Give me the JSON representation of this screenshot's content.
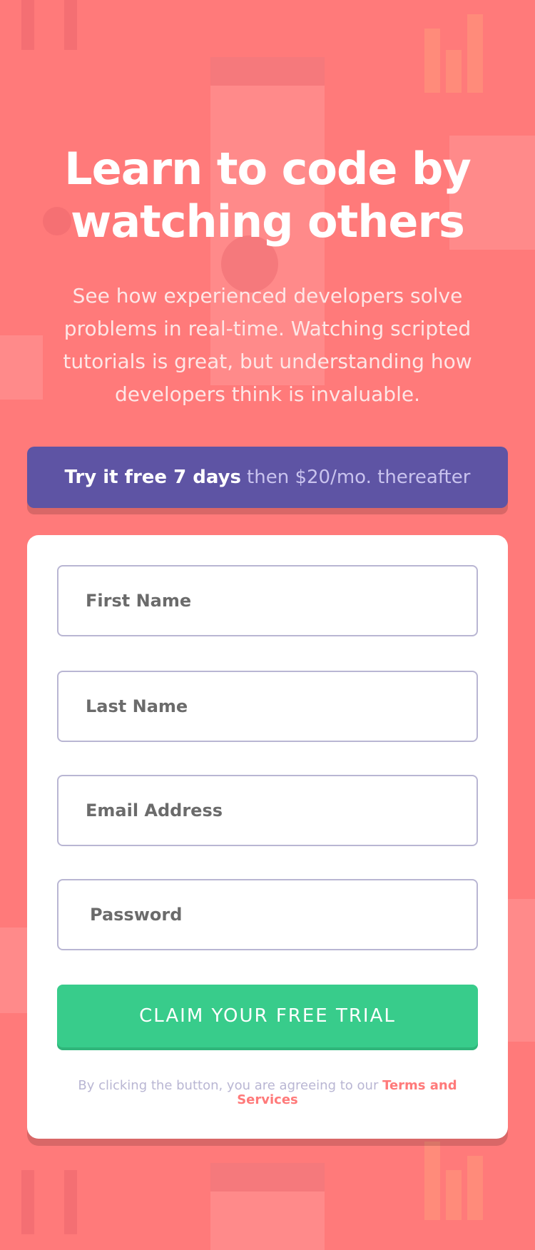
{
  "hero": {
    "title_line1": "Learn to code by",
    "title_line2": "watching others",
    "subtitle": "See how experienced developers solve problems in real-time. Watching scripted tutorials is great, but understanding how developers think is invaluable."
  },
  "banner": {
    "strong": "Try it free 7 days",
    "light": "then $20/mo. thereafter"
  },
  "form": {
    "first_name_placeholder": "First Name",
    "last_name_placeholder": "Last Name",
    "email_placeholder": "Email Address",
    "password_placeholder": "Password",
    "submit_label": "CLAIM YOUR FREE TRIAL",
    "terms_prefix": "By clicking the button, you are agreeing to our",
    "terms_link": "Terms and Services"
  },
  "colors": {
    "background": "#ff7a7a",
    "banner": "#5e54a4",
    "submit": "#38cc8b",
    "field_border": "#b9b6d3",
    "terms_link": "#ff7a7a"
  }
}
